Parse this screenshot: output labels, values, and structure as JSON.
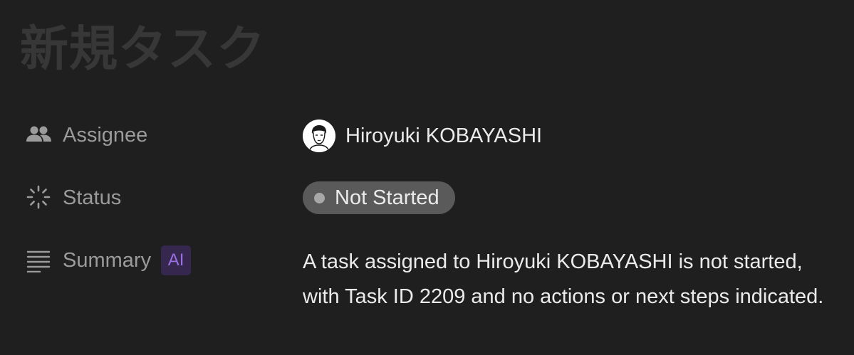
{
  "page": {
    "title": "新規タスク"
  },
  "properties": {
    "assignee": {
      "label": "Assignee",
      "icon": "people-icon",
      "name": "Hiroyuki KOBAYASHI"
    },
    "status": {
      "label": "Status",
      "icon": "loading-spinner-icon",
      "value": "Not Started",
      "pill_color": "#5a5a5a",
      "dot_color": "#a8a8a8"
    },
    "summary": {
      "label": "Summary",
      "icon": "text-lines-icon",
      "badge": "AI",
      "badge_color": "#9a6fe0",
      "text": "A task assigned to Hiroyuki KOBAYASHI is not started, with Task ID 2209 and no actions or next steps indicated."
    }
  }
}
